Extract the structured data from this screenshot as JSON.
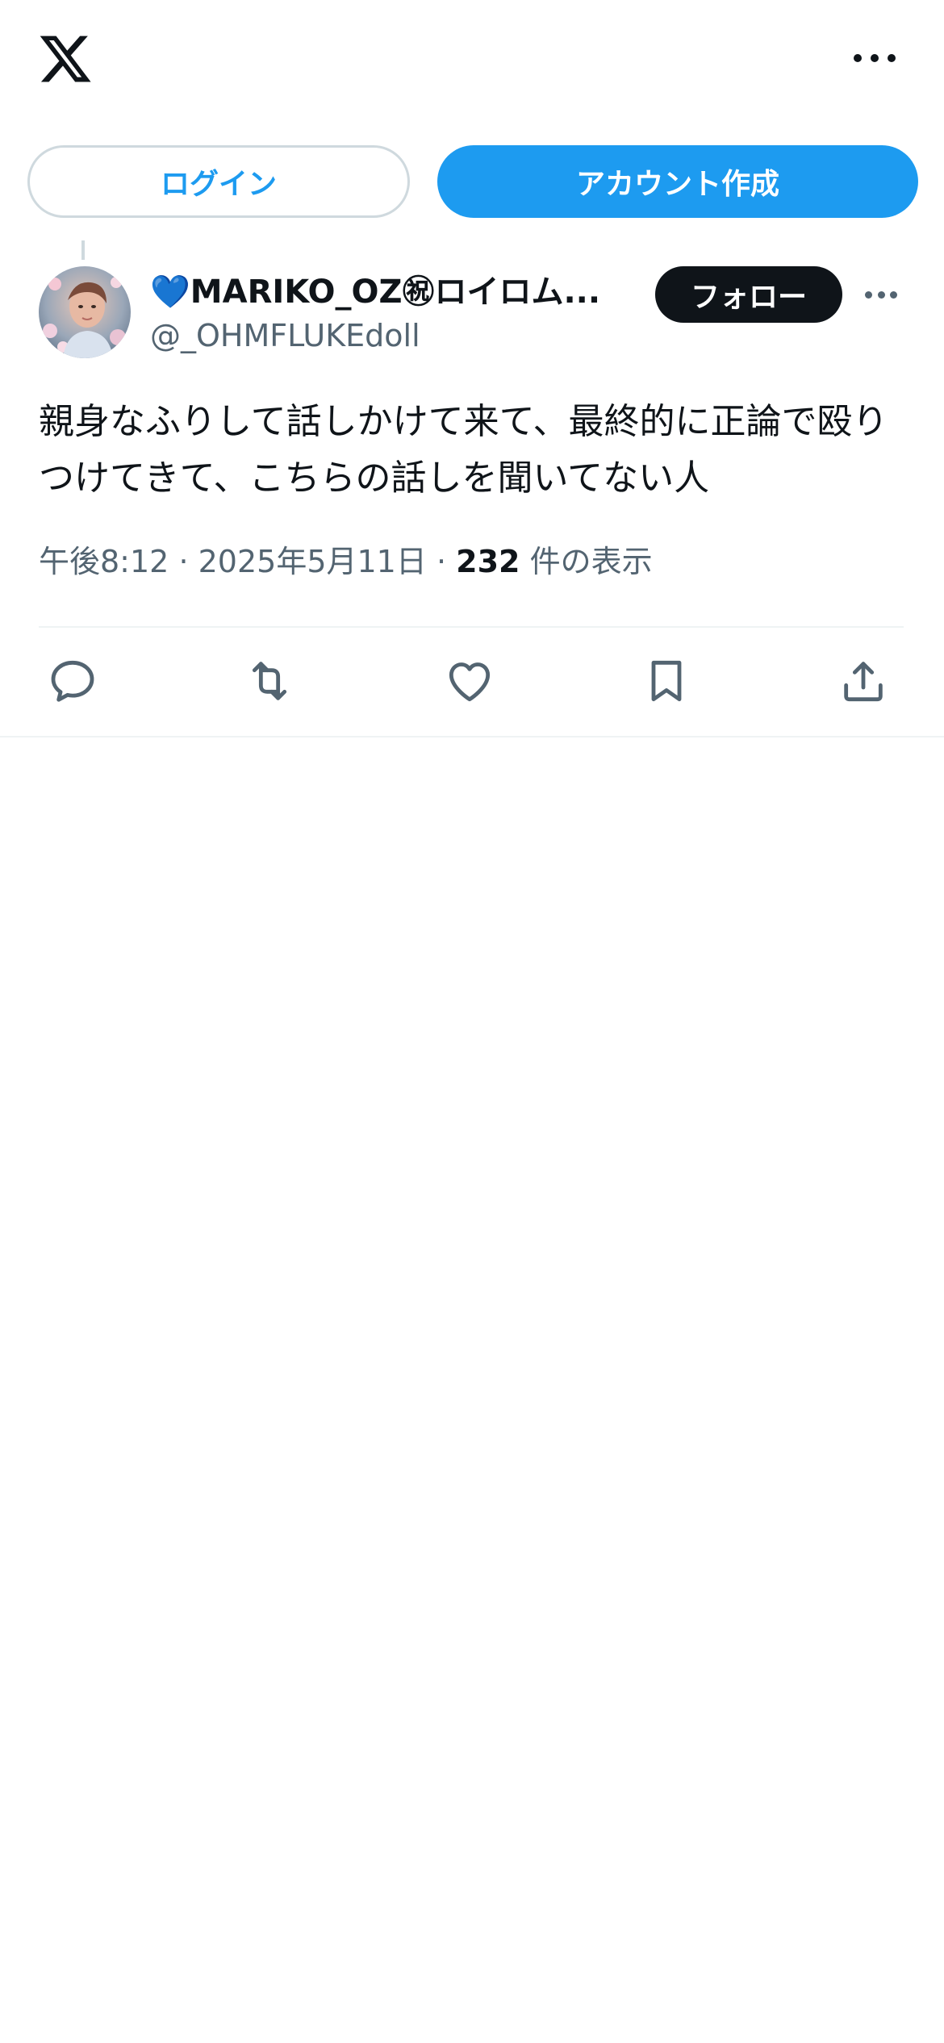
{
  "header": {
    "logo_icon": "x-logo-icon",
    "more_icon": "more-horizontal-icon"
  },
  "auth": {
    "login_label": "ログイン",
    "signup_label": "アカウント作成"
  },
  "post": {
    "author": {
      "display_name": "💙MARIKO_OZ㊗ロイロム...",
      "handle": "@_OHMFLUKEdoll",
      "avatar_icon": "user-avatar"
    },
    "follow_label": "フォロー",
    "text": "親身なふりして話しかけて来て、最終的に正論で殴りつけてきて、こちらの話しを聞いてない人",
    "time": "午後8:12",
    "date": "2025年5月11日",
    "separator": "·",
    "views_count": "232",
    "views_label": "件の表示"
  },
  "actions": [
    {
      "name": "reply",
      "icon": "reply-icon"
    },
    {
      "name": "repost",
      "icon": "repost-icon"
    },
    {
      "name": "like",
      "icon": "heart-icon"
    },
    {
      "name": "bookmark",
      "icon": "bookmark-icon"
    },
    {
      "name": "share",
      "icon": "share-icon"
    }
  ],
  "colors": {
    "accent": "#1d9bf0",
    "text_primary": "#0f1419",
    "text_secondary": "#536471",
    "border": "#cfd9de"
  }
}
